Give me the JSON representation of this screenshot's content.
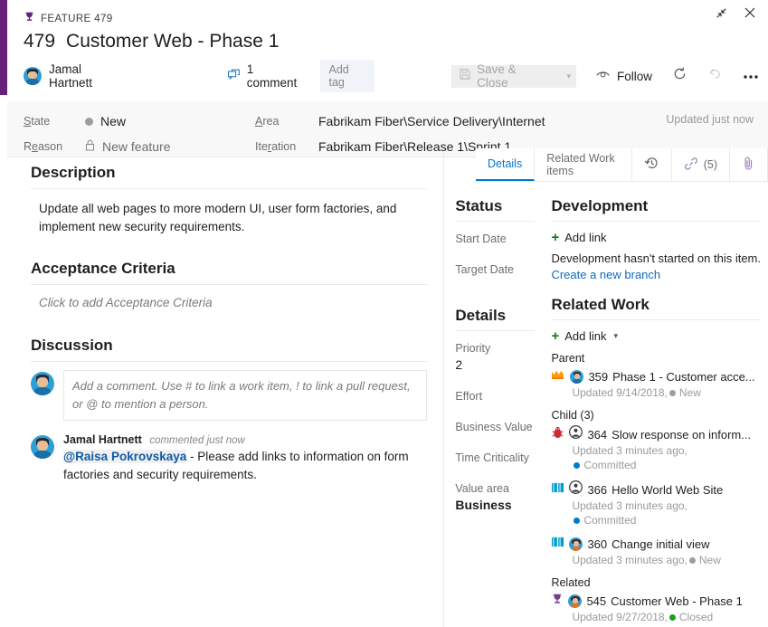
{
  "window": {
    "restore_icon": "restore-icon",
    "close_icon": "close-icon"
  },
  "header": {
    "type_icon": "trophy-icon",
    "type_label": "FEATURE 479",
    "id": "479",
    "title": "Customer Web - Phase 1",
    "assigned_to": "Jamal Hartnett",
    "comment_count_label": "1 comment",
    "comment_icon": "comment-icon",
    "add_tag_label": "Add tag",
    "save_close_label": "Save & Close",
    "save_icon": "save-icon",
    "save_caret": "▾",
    "follow_label": "Follow",
    "follow_icon": "eye-icon",
    "refresh_icon": "refresh-icon",
    "undo_icon": "undo-icon",
    "more_icon": "ellipsis-icon"
  },
  "fields": {
    "state_label": "State",
    "state_value": "New",
    "state_color": "#9e9e9e",
    "reason_label": "Reason",
    "reason_value": "New feature",
    "reason_icon": "lock-icon",
    "area_label": "Area",
    "area_value": "Fabrikam Fiber\\Service Delivery\\Internet",
    "iteration_label": "Iteration",
    "iteration_value": "Fabrikam Fiber\\Release 1\\Sprint 1",
    "updated_text": "Updated just now"
  },
  "tabs": [
    {
      "label": "Details",
      "icon": "",
      "active": true
    },
    {
      "label": "Related Work items",
      "icon": "",
      "active": false
    },
    {
      "label": "",
      "icon": "history-icon",
      "active": false
    },
    {
      "label": "(5)",
      "icon": "link-icon",
      "active": false
    },
    {
      "label": "",
      "icon": "attachment-icon",
      "active": false
    }
  ],
  "description": {
    "heading": "Description",
    "text": "Update all web pages to more modern UI, user form factories, and implement new security requirements."
  },
  "acceptance_criteria": {
    "heading": "Acceptance Criteria",
    "placeholder": "Click to add Acceptance Criteria"
  },
  "discussion": {
    "heading": "Discussion",
    "input_placeholder": "Add a comment. Use # to link a work item, ! to link a pull request, or @ to mention a person.",
    "comment": {
      "author": "Jamal Hartnett",
      "time": "commented just now",
      "mention": "@Raisa Pokrovskaya",
      "text": " - Please add links to information on form factories and security requirements."
    }
  },
  "status_panel": {
    "heading": "Status",
    "fields": [
      {
        "label": "Start Date",
        "value": ""
      },
      {
        "label": "Target Date",
        "value": ""
      }
    ]
  },
  "details_panel": {
    "heading": "Details",
    "fields": [
      {
        "label": "Priority",
        "value": "2",
        "bold": false
      },
      {
        "label": "Effort",
        "value": "",
        "bold": false
      },
      {
        "label": "Business Value",
        "value": "",
        "bold": false
      },
      {
        "label": "Time Criticality",
        "value": "",
        "bold": false
      },
      {
        "label": "Value area",
        "value": "Business",
        "bold": true
      }
    ]
  },
  "development": {
    "heading": "Development",
    "add_link_label": "Add link",
    "empty_text": "Development hasn't started on this item.",
    "branch_link": "Create a new branch"
  },
  "related_work": {
    "heading": "Related Work",
    "add_link_label": "Add link",
    "groups": [
      {
        "label": "Parent",
        "items": [
          {
            "type_icon": "epic-icon",
            "avatar": "male",
            "id": "359",
            "title": "Phase 1 - Customer acce...",
            "updated": "Updated 9/14/2018,",
            "state": "New",
            "state_color": "#9e9e9e",
            "wrap": false
          }
        ]
      },
      {
        "label": "Child (3)",
        "items": [
          {
            "type_icon": "bug-icon",
            "avatar": "generic",
            "id": "364",
            "title": "Slow response on inform...",
            "updated": "Updated 3 minutes ago,",
            "state": "Committed",
            "state_color": "#007acc",
            "wrap": true
          },
          {
            "type_icon": "story-icon",
            "avatar": "generic",
            "id": "366",
            "title": "Hello World Web Site",
            "updated": "Updated 3 minutes ago,",
            "state": "Committed",
            "state_color": "#007acc",
            "wrap": true
          },
          {
            "type_icon": "story-icon",
            "avatar": "female",
            "id": "360",
            "title": "Change initial view",
            "updated": "Updated 3 minutes ago,",
            "state": "New",
            "state_color": "#9e9e9e",
            "wrap": false
          }
        ]
      },
      {
        "label": "Related",
        "items": [
          {
            "type_icon": "feature-icon",
            "avatar": "female",
            "id": "545",
            "title": "Customer Web - Phase 1",
            "updated": "Updated 9/27/2018,",
            "state": "Closed",
            "state_color": "#1d9e1d",
            "wrap": false
          }
        ]
      }
    ]
  },
  "colors": {
    "feature_purple": "#68217a",
    "accent_blue": "#0078d4",
    "link_blue": "#0f6cbd",
    "add_green": "#107c10"
  }
}
